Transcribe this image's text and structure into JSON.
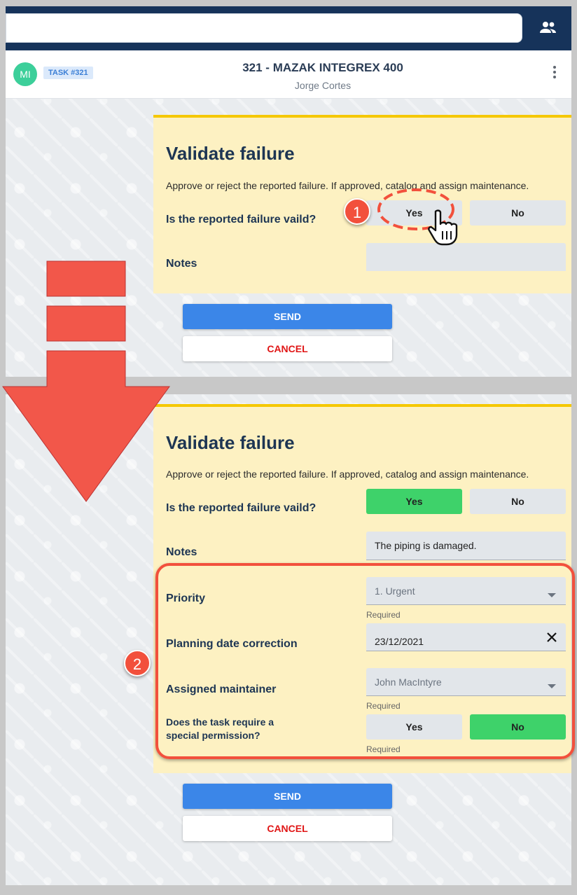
{
  "header": {
    "avatar_initials": "MI",
    "task_badge": "TASK #321",
    "title": "321 - MAZAK INTEGREX 400",
    "subtitle": "Jorge Cortes"
  },
  "form_before": {
    "title": "Validate failure",
    "description": "Approve or reject the reported failure. If approved, catalog and assign maintenance.",
    "valid_question": "Is the reported failure vaild?",
    "yes_label": "Yes",
    "no_label": "No",
    "notes_label": "Notes",
    "notes_value": "",
    "send_label": "SEND",
    "cancel_label": "CANCEL"
  },
  "form_after": {
    "title": "Validate failure",
    "description": "Approve or reject the reported failure. If approved, catalog and assign maintenance.",
    "valid_question": "Is the reported failure vaild?",
    "yes_label": "Yes",
    "no_label": "No",
    "notes_label": "Notes",
    "notes_value": "The piping is damaged.",
    "priority_label": "Priority",
    "priority_value": "1. Urgent",
    "planning_label": "Planning date correction",
    "planning_value": "23/12/2021",
    "maintainer_label": "Assigned maintainer",
    "maintainer_value": "John MacIntyre",
    "permission_label_line1": "Does the task require a",
    "permission_label_line2": "special permission?",
    "perm_yes_label": "Yes",
    "perm_no_label": "No",
    "required_text": "Required",
    "send_label": "SEND",
    "cancel_label": "CANCEL"
  },
  "annotations": {
    "step1": "1",
    "step2": "2",
    "accent_color": "#f2503c"
  },
  "colors": {
    "navy": "#16335a",
    "card_bg": "#fdf1c2",
    "card_border": "#f5c800",
    "selected_green": "#3ed26a",
    "send_blue": "#3b86e8",
    "cancel_red": "#e01616"
  },
  "icons": [
    "people-icon",
    "more-vertical-icon",
    "hand-pointer-icon",
    "close-icon",
    "dropdown-caret-icon",
    "down-arrow-icon"
  ]
}
